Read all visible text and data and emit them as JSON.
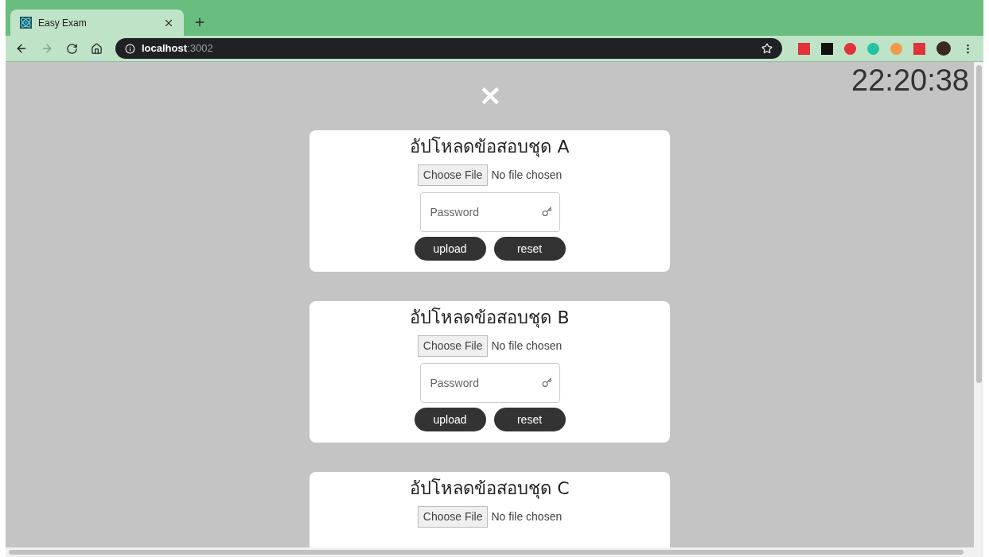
{
  "browser": {
    "tab": {
      "title": "Easy Exam",
      "selected": true
    },
    "address": {
      "host": "localhost",
      "port": ":3002"
    }
  },
  "clock": "22:20:38",
  "close_symbol": "✕",
  "cards": [
    {
      "title": "อัปโหลดข้อสอบชุด A",
      "file_button": "Choose File",
      "file_status": "No file chosen",
      "password": {
        "placeholder": "Password"
      },
      "buttons": [
        "upload",
        "reset"
      ]
    },
    {
      "title": "อัปโหลดข้อสอบชุด B",
      "file_button": "Choose File",
      "file_status": "No file chosen",
      "password": {
        "placeholder": "Password"
      },
      "buttons": [
        "upload",
        "reset"
      ]
    },
    {
      "title": "อัปโหลดข้อสอบชุด C",
      "file_button": "Choose File",
      "file_status": "No file chosen"
    }
  ]
}
